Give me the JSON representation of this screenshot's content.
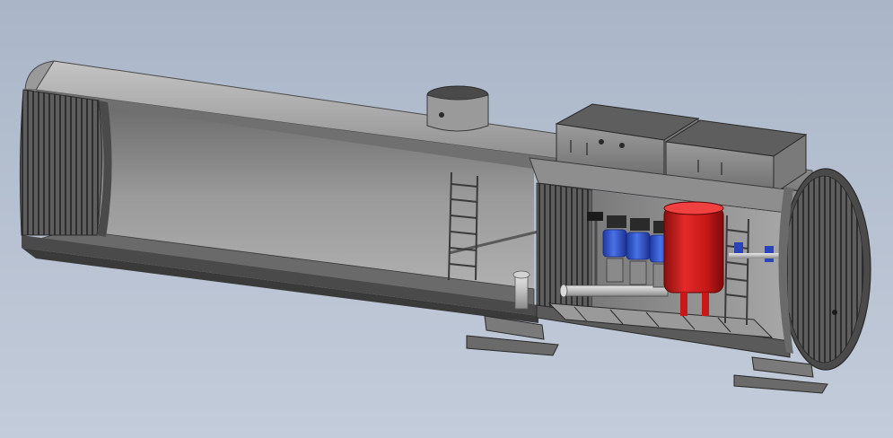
{
  "scene": {
    "subject": "cutaway-tank-pump-station",
    "background_colors": [
      "#aab6c8",
      "#c3ccda"
    ],
    "colors": {
      "shell_top": "#9a9a9a",
      "shell_light": "#b4b4b4",
      "shell_mid": "#8a8a8a",
      "shell_dark": "#5a5a5a",
      "rib": "#3a3a3a",
      "pipe": "#c8c8c8",
      "pump_body": "#3a5fd0",
      "pump_motor": "#2a2a2a",
      "pressure_tank": "#d41a1a",
      "valve_blue": "#2a44b8",
      "frame": "#7a7a7a"
    },
    "components": [
      "cylindrical-tank-shell",
      "end-cap-rear",
      "end-cap-front",
      "manhole-neck",
      "access-ladder-left",
      "access-ladder-right",
      "equipment-hopper-left",
      "equipment-hopper-right",
      "pump-group",
      "red-pressure-tank",
      "skid-frame",
      "support-saddle-left",
      "support-saddle-right"
    ]
  }
}
